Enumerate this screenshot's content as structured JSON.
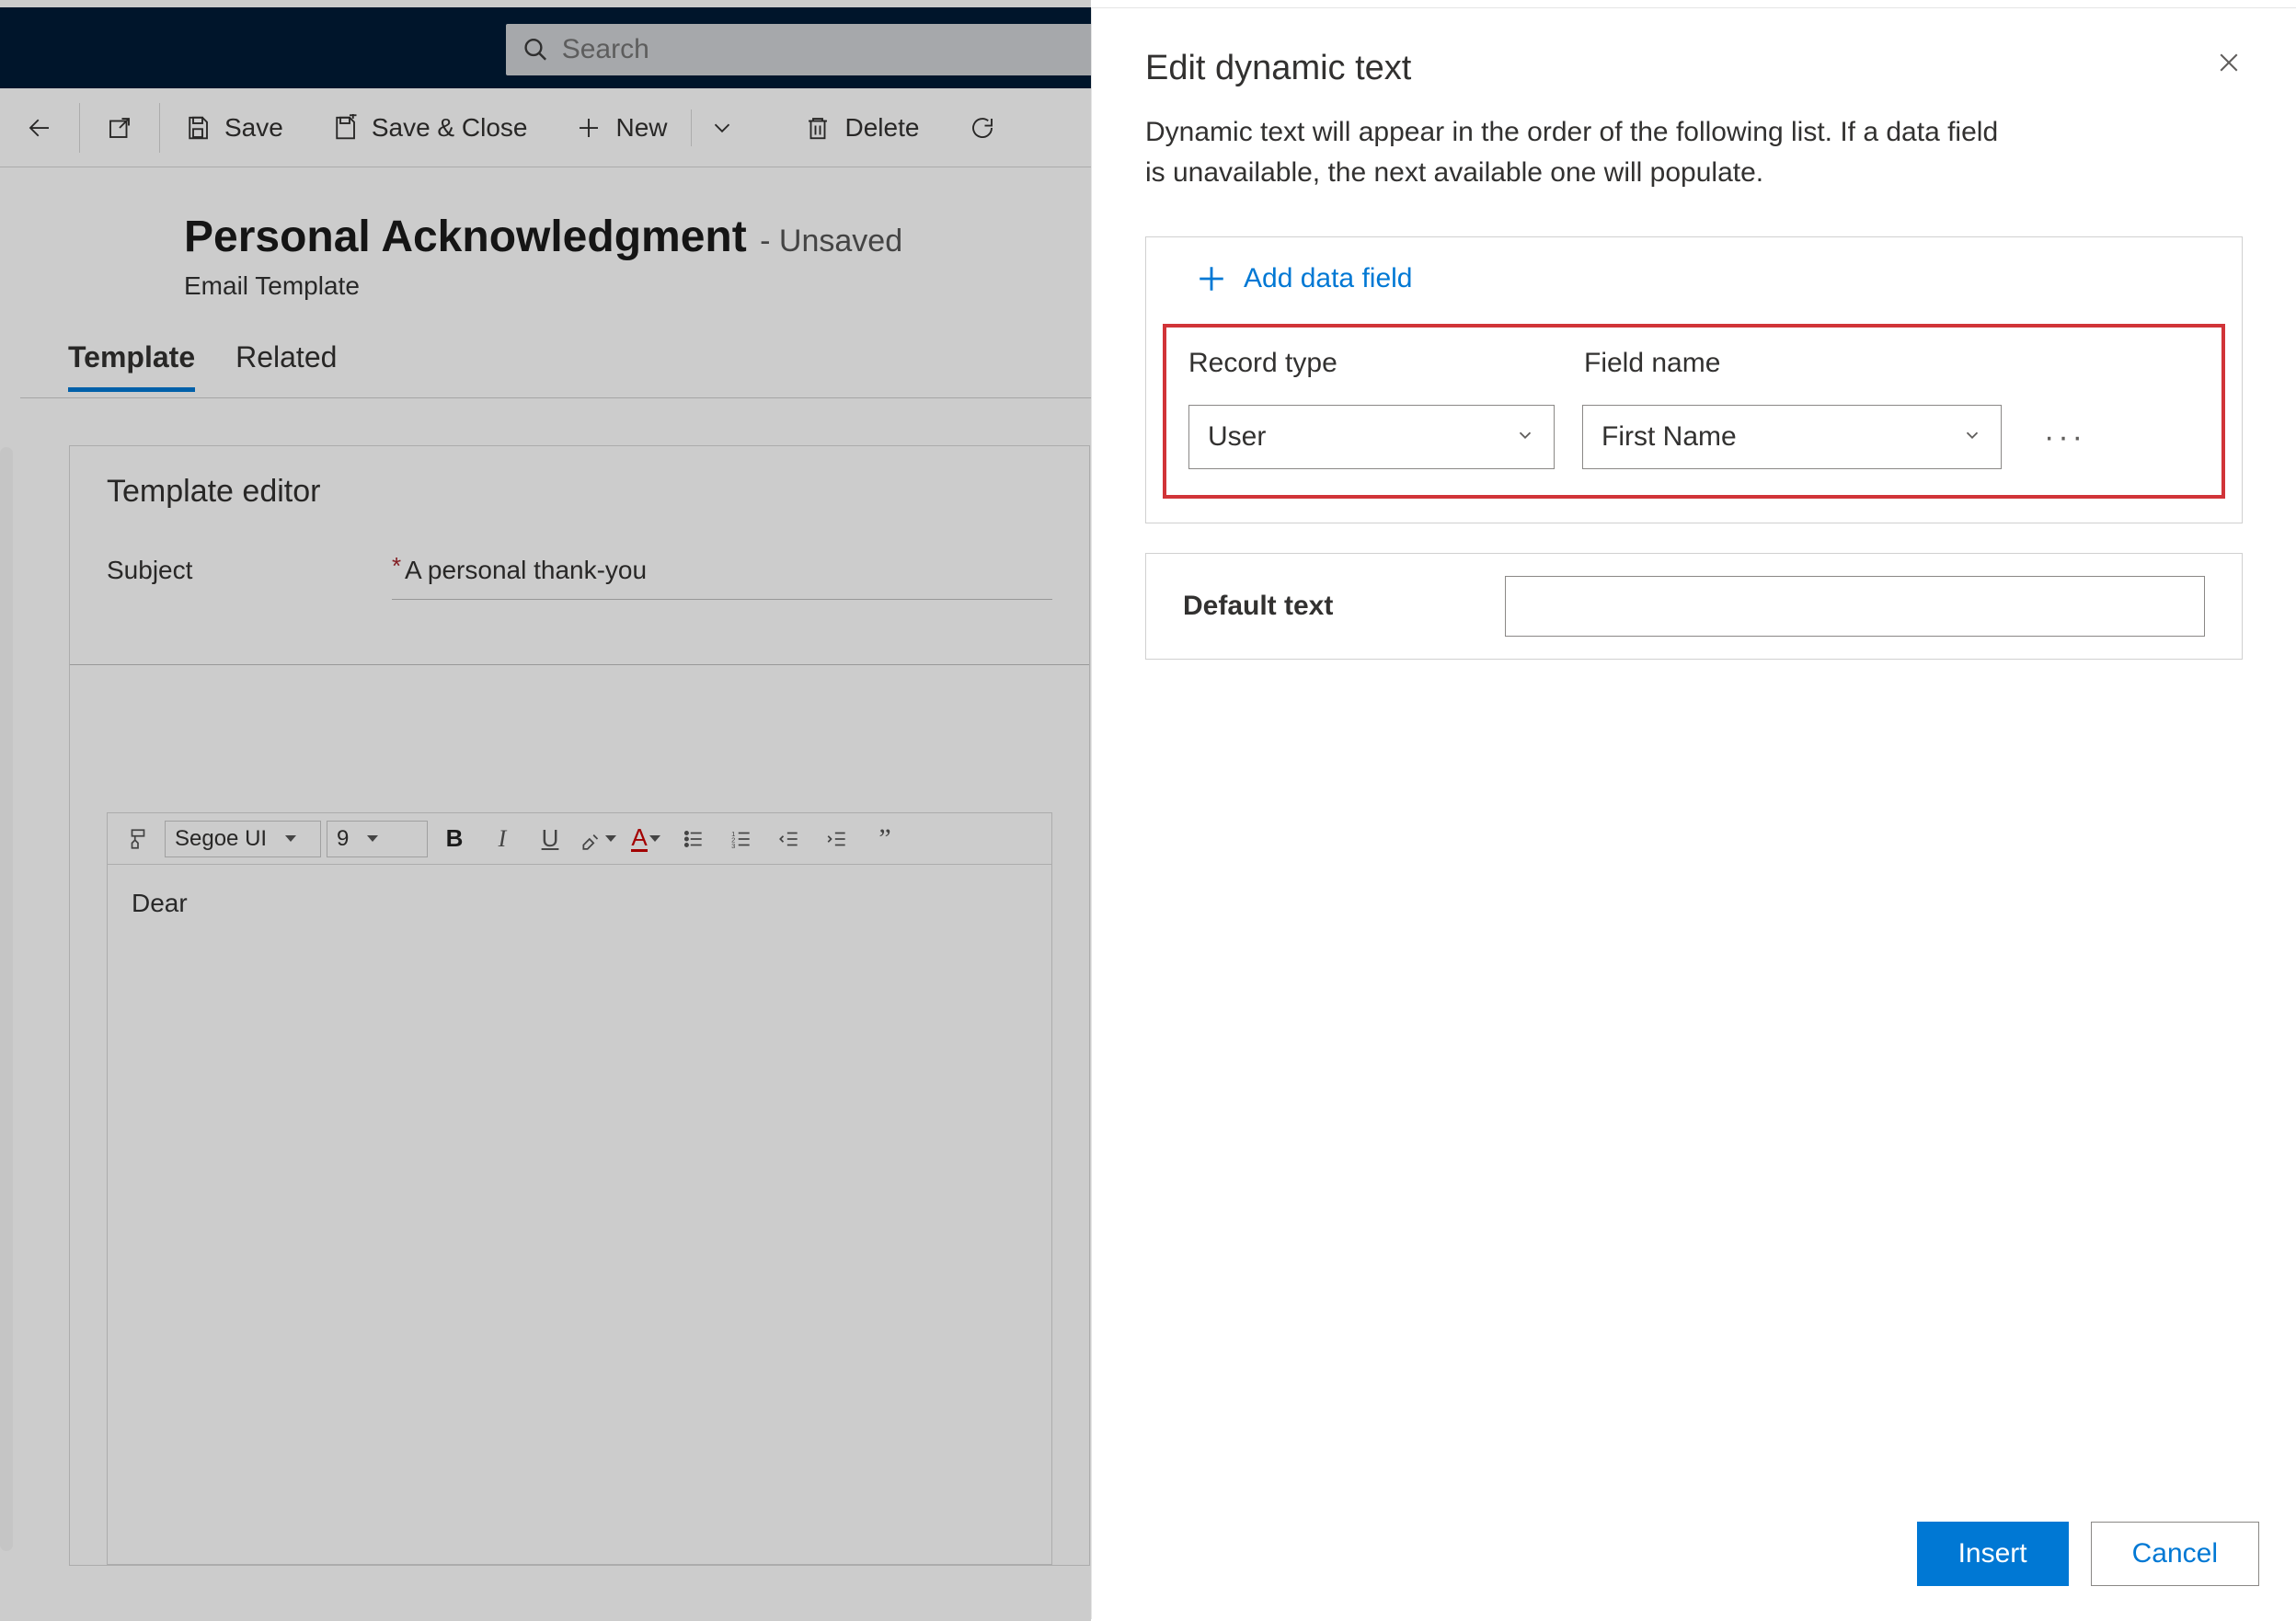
{
  "search": {
    "placeholder": "Search"
  },
  "commands": {
    "save": "Save",
    "save_close": "Save & Close",
    "new": "New",
    "delete": "Delete"
  },
  "header": {
    "title": "Personal Acknowledgment",
    "status": "- Unsaved",
    "subtitle": "Email Template"
  },
  "tabs": {
    "template": "Template",
    "related": "Related"
  },
  "editor": {
    "section_title": "Template editor",
    "subject_label": "Subject",
    "subject_value": "A personal thank-you",
    "font_name": "Segoe UI",
    "font_size": "9",
    "body_text": "Dear"
  },
  "flyout": {
    "title": "Edit dynamic text",
    "description": "Dynamic text will appear in the order of the following list. If a data field is unavailable, the next available one will populate.",
    "add_label": "Add data field",
    "col_record_type": "Record type",
    "col_field_name": "Field name",
    "record_type_value": "User",
    "field_name_value": "First Name",
    "default_label": "Default text",
    "default_value": "",
    "insert": "Insert",
    "cancel": "Cancel"
  }
}
